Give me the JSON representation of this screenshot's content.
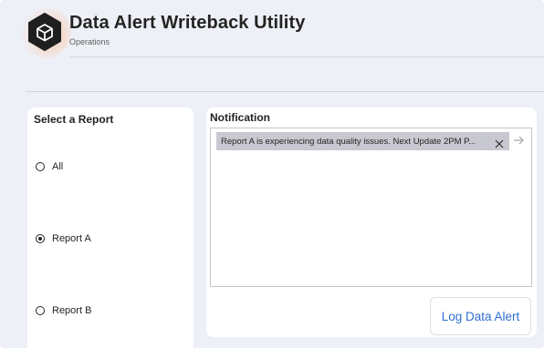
{
  "header": {
    "title": "Data Alert Writeback Utility",
    "subtitle": "Operations",
    "logo_icon": "cube-icon"
  },
  "report_selector": {
    "title": "Select a Report",
    "options": [
      {
        "label": "All",
        "selected": false
      },
      {
        "label": "Report A",
        "selected": true
      },
      {
        "label": "Report B",
        "selected": false
      }
    ]
  },
  "notification": {
    "title": "Notification",
    "chip_text": "Report A is experiencing data quality issues. Next Update 2PM P...",
    "close_icon": "close-icon",
    "submit_icon": "arrow-right-icon"
  },
  "actions": {
    "log_label": "Log Data Alert"
  },
  "colors": {
    "background": "#eef0f8",
    "card": "#ffffff",
    "chip": "#c8c8d0",
    "accent": "#2f6fd0"
  }
}
